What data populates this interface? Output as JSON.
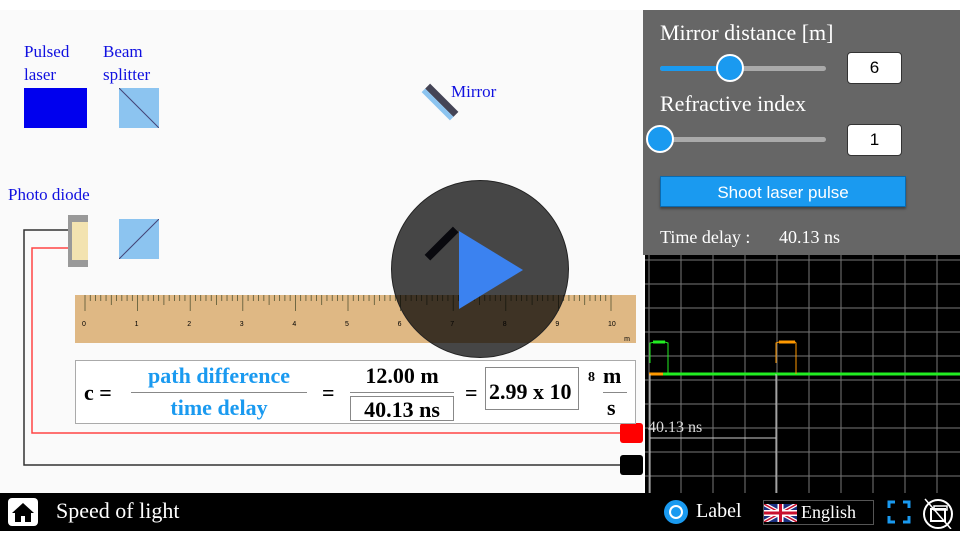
{
  "stage": {
    "labels": {
      "pulsed_laser_1": "Pulsed",
      "pulsed_laser_2": "laser",
      "beam_splitter_1": "Beam",
      "beam_splitter_2": "splitter",
      "mirror": "Mirror",
      "photo_diode": "Photo diode"
    },
    "ruler": {
      "ticks": [
        "0",
        "1",
        "2",
        "3",
        "4",
        "5",
        "6",
        "7",
        "8",
        "9",
        "10"
      ],
      "unit": "m"
    },
    "equation": {
      "lhs": "c =",
      "numerator": "path difference",
      "denominator": "time delay",
      "eq1": "=",
      "value_num": "12.00 m",
      "value_den": "40.13 ns",
      "eq2": "=",
      "result": "2.99 x 10",
      "exponent": "8",
      "unit_num": "m",
      "unit_den": "s"
    }
  },
  "panel": {
    "mirror_distance": {
      "label": "Mirror distance [m]",
      "value": "6",
      "slider_fraction": 0.42
    },
    "refractive_index": {
      "label": "Refractive index",
      "value": "1",
      "slider_fraction": 0.0
    },
    "shoot_button": "Shoot laser pulse",
    "time_delay_label": "Time delay :",
    "time_delay_value": "40.13 ns"
  },
  "scope": {
    "delay_label": "40.13 ns",
    "colors": {
      "trace": "#22ee22",
      "pulse_out": "#22ee22",
      "pulse_return": "#ff9900"
    }
  },
  "bottom": {
    "title": "Speed of light",
    "label_toggle": "Label",
    "language": "English"
  },
  "colors": {
    "accent": "#1a9af0",
    "label_text": "#1010e0",
    "laser": "#0000ee"
  }
}
